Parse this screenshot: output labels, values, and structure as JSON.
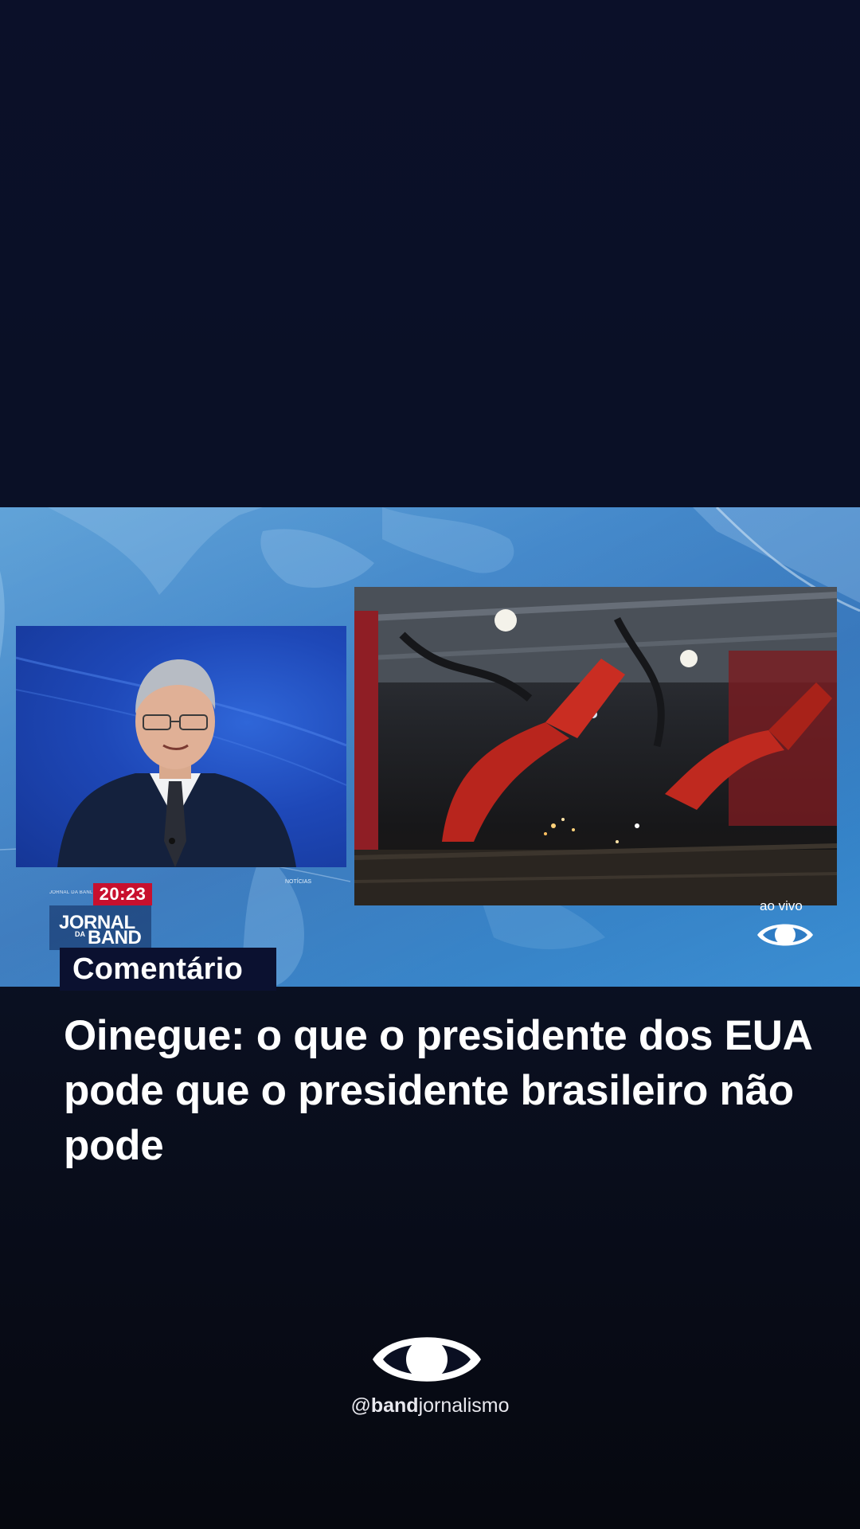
{
  "broadcast": {
    "clock": "20:23",
    "clock_strip": "JORNAL DA BAND",
    "show_logo": {
      "line1": "JORNAL",
      "line2": "DA",
      "line3": "BAND"
    },
    "live_label": "ao vivo",
    "map_label": "NOTÍCIAS"
  },
  "section_tag": "Comentário",
  "headline": "Oinegue: o que o presidente dos EUA pode que o presidente brasileiro não pode",
  "brand": {
    "handle_prefix": "@",
    "handle_bold": "band",
    "handle_rest": "jornalismo"
  },
  "colors": {
    "background": "#0b1029",
    "broadcast_blue": "#2f7cc4",
    "clock_red": "#c8102e",
    "tag_bg": "#0b1130"
  }
}
